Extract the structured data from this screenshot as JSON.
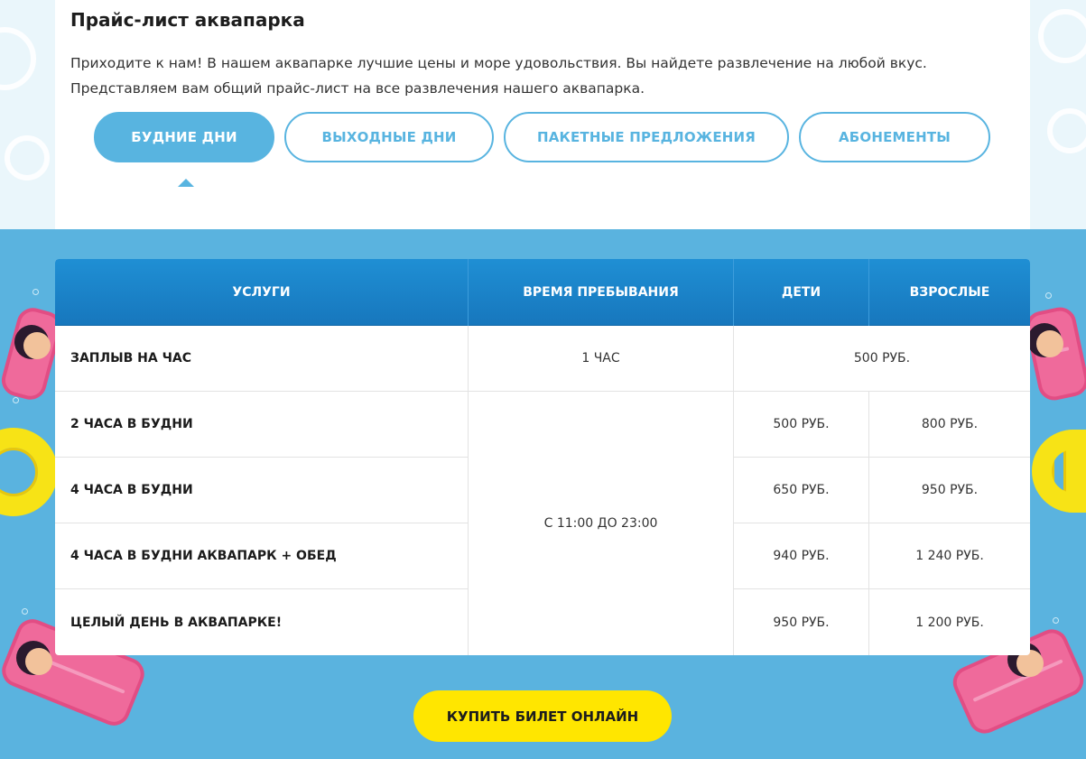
{
  "header": {
    "title": "Прайс-лист аквапарка",
    "intro_line1": "Приходите к нам! В нашем аквапарке лучшие цены и море удовольствия. Вы найдете развлечение на любой вкус.",
    "intro_line2": "Представляем вам общий прайс-лист на все развлечения нашего аквапарка."
  },
  "tabs": [
    {
      "label": "БУДНИЕ ДНИ",
      "active": true
    },
    {
      "label": "ВЫХОДНЫЕ ДНИ",
      "active": false
    },
    {
      "label": "ПАКЕТНЫЕ ПРЕДЛОЖЕНИЯ",
      "active": false
    },
    {
      "label": "АБОНЕМЕНТЫ",
      "active": false
    }
  ],
  "table": {
    "headers": [
      "УСЛУГИ",
      "ВРЕМЯ ПРЕБЫВАНИЯ",
      "ДЕТИ",
      "ВЗРОСЛЫЕ"
    ],
    "rows": [
      {
        "service": "ЗАПЛЫВ НА ЧАС",
        "time": "1 ЧАС",
        "combined_price": "500 РУБ."
      },
      {
        "service": "2 ЧАСА В БУДНИ",
        "children": "500 РУБ.",
        "adults": "800 РУБ."
      },
      {
        "service": "4 ЧАСА В БУДНИ",
        "children": "650 РУБ.",
        "adults": "950 РУБ."
      },
      {
        "service": "4 ЧАСА В БУДНИ АКВАПАРК + ОБЕД",
        "children": "940 РУБ.",
        "adults": "1 240 РУБ."
      },
      {
        "service": "ЦЕЛЫЙ ДЕНЬ В АКВАПАРКЕ!",
        "children": "950 РУБ.",
        "adults": "1 200 РУБ."
      }
    ],
    "merged_time": "С 11:00 ДО 23:00"
  },
  "buy_button": {
    "label": "КУПИТЬ БИЛЕТ ОНЛАЙН"
  },
  "colors": {
    "accent": "#58b4e0",
    "pool": "#5ab3df",
    "table_header": "#1a84c9",
    "buy_button": "#ffe600"
  }
}
